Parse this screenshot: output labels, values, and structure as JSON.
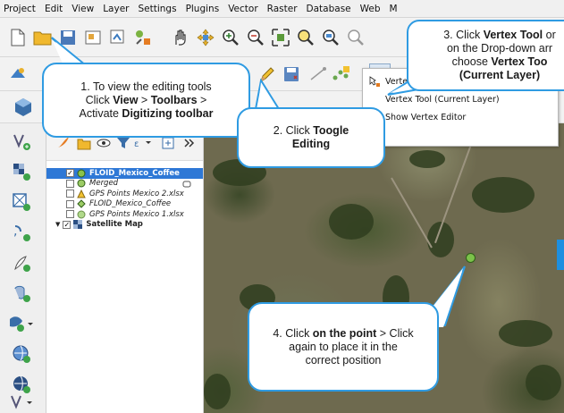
{
  "menu": [
    "Project",
    "Edit",
    "View",
    "Layer",
    "Settings",
    "Plugins",
    "Vector",
    "Raster",
    "Database",
    "Web",
    "M"
  ],
  "dropdown": {
    "items": [
      "Vertex Tool (All Layers)",
      "Vertex Tool (Current Layer)",
      "Show Vertex Editor"
    ]
  },
  "layers": [
    {
      "name": "FLOID_Mexico_Coffee",
      "checked": true,
      "selected": true
    },
    {
      "name": "Merged",
      "checked": false
    },
    {
      "name": "GPS Points Mexico 2.xlsx",
      "checked": false
    },
    {
      "name": "FLOID_Mexico_Coffee",
      "checked": false
    },
    {
      "name": "GPS Points Mexico 1.xlsx",
      "checked": false
    },
    {
      "name": "Satellite Map",
      "checked": true
    }
  ],
  "callouts": {
    "c1": {
      "p1": "1. To view the editing tools",
      "p2": "Click ",
      "b1": "View",
      "p3": " > ",
      "b2": "Toolbars",
      "p4": " >",
      "p5": "Activate ",
      "b3": "Digitizing toolbar"
    },
    "c2": {
      "p1": "2. Click ",
      "b1": "Toogle",
      "b2": "Editing"
    },
    "c3": {
      "p1": "3. Click ",
      "b1": "Vertex Tool",
      "p2": " or",
      "p3": "on the Drop-down arr",
      "p4": "choose ",
      "b2": "Vertex Too",
      "b3": "(Current Layer)"
    },
    "c4": {
      "p1": "4. Click ",
      "b1": "on the point",
      "p2": " > Click",
      "p3": "again to place it in the",
      "p4": "correct position"
    }
  },
  "colors": {
    "accent": "#2f9be2",
    "selection": "#2e78d6",
    "point": "#7cc24a"
  }
}
